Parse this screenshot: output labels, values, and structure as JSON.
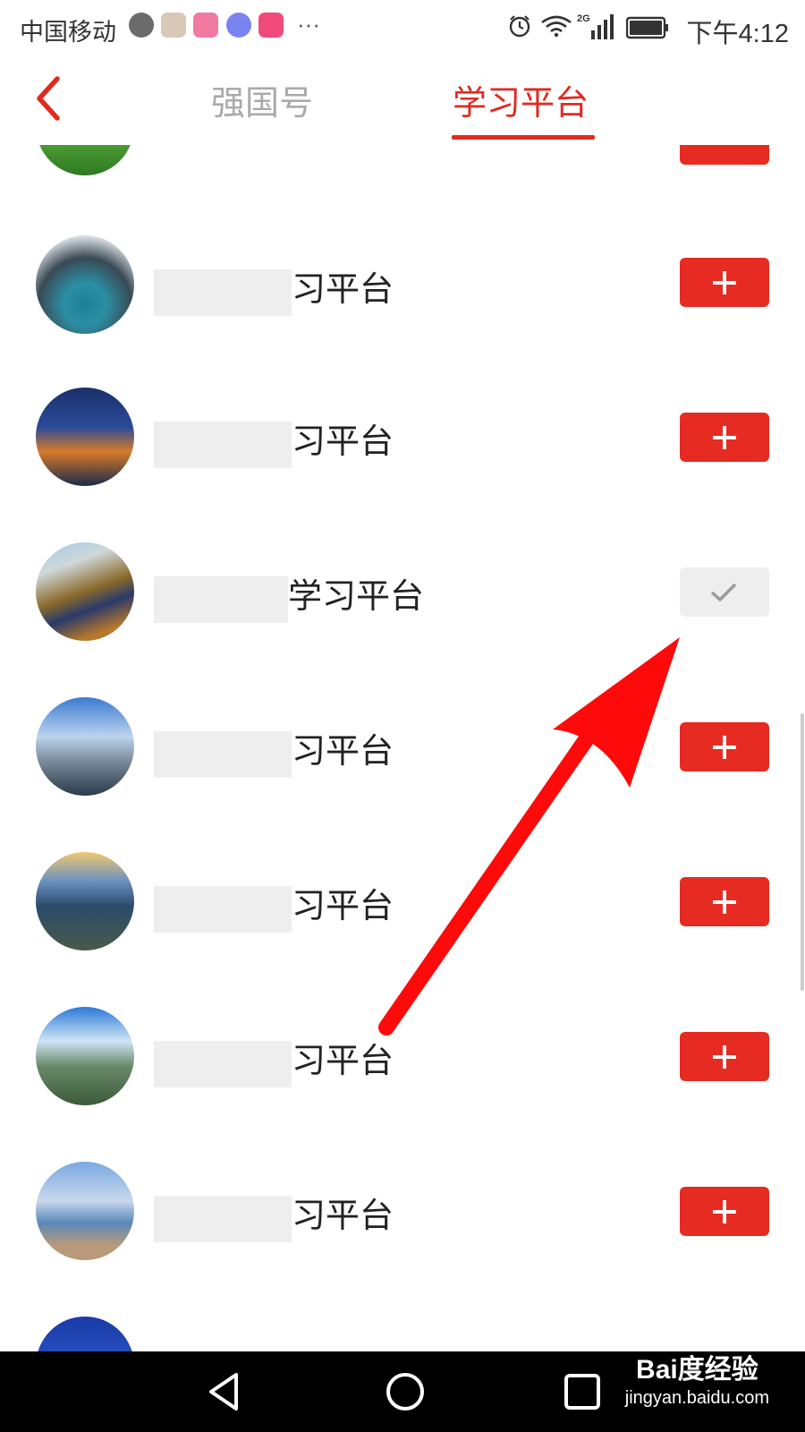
{
  "status_bar": {
    "carrier": "中国移动",
    "more": "···",
    "network": "2G",
    "time": "下午4:12"
  },
  "header": {
    "back_icon": "chevron-left-icon",
    "tabs": [
      {
        "label": "强国号",
        "active": false
      },
      {
        "label": "学习平台",
        "active": true
      }
    ],
    "accent_color": "#e02a20"
  },
  "list": {
    "items": [
      {
        "name_suffix": "",
        "followed": false
      },
      {
        "name_suffix": "习平台",
        "followed": false
      },
      {
        "name_suffix": "习平台",
        "followed": false
      },
      {
        "name_suffix": "学习平台",
        "followed": true
      },
      {
        "name_suffix": "习平台",
        "followed": false
      },
      {
        "name_suffix": "习平台",
        "followed": false
      },
      {
        "name_suffix": "习平台",
        "followed": false
      },
      {
        "name_suffix": "习平台",
        "followed": false
      },
      {
        "name_suffix": "",
        "followed": false
      }
    ],
    "follow_icon": "plus-icon",
    "followed_icon": "check-icon",
    "button_color": "#e52b22",
    "followed_color": "#eeeeee"
  },
  "annotation": {
    "arrow_color": "#ff0a0a"
  },
  "system_nav": {
    "back_icon": "triangle-back-icon",
    "home_icon": "circle-home-icon",
    "recent_icon": "square-recent-icon"
  },
  "watermark": {
    "brand": "Bai度经验",
    "url": "jingyan.baidu.com"
  }
}
